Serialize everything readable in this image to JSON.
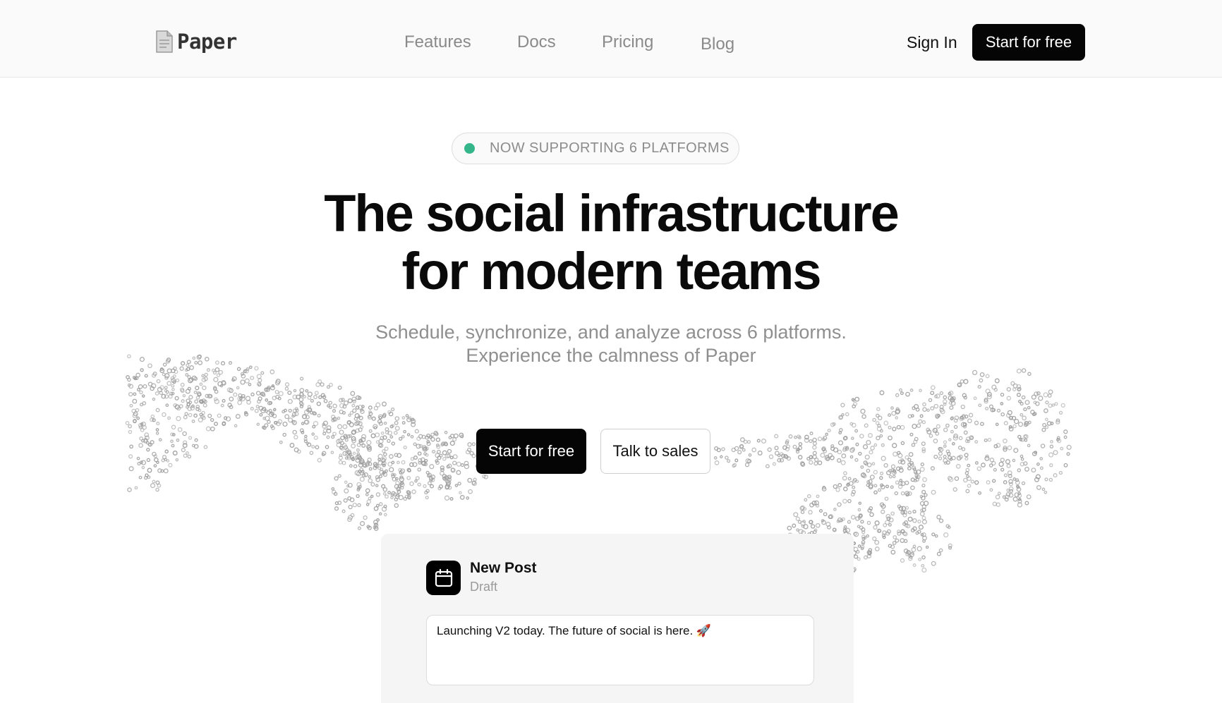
{
  "brand": {
    "name": "Paper",
    "icon": "paper-document-icon"
  },
  "nav": {
    "links": [
      "Features",
      "Docs",
      "Pricing",
      "Blog"
    ],
    "sign_in": "Sign In",
    "cta": "Start for free"
  },
  "hero": {
    "badge": "NOW SUPPORTING 6 PLATFORMS",
    "badge_dot_color": "#34b58a",
    "title_line1": "The social infrastructure",
    "title_line2": "for modern teams",
    "subtitle_line1": "Schedule, synchronize, and analyze across 6 platforms.",
    "subtitle_line2": "Experience the calmness of Paper",
    "primary_cta": "Start for free",
    "secondary_cta": "Talk to sales"
  },
  "preview": {
    "icon": "calendar-icon",
    "title": "New Post",
    "status": "Draft",
    "composer_text": "Launching V2 today. The future of social is here. 🚀"
  },
  "colors": {
    "accent": "#050505",
    "muted_text": "#8f8f8f",
    "status_green": "#34b58a"
  }
}
